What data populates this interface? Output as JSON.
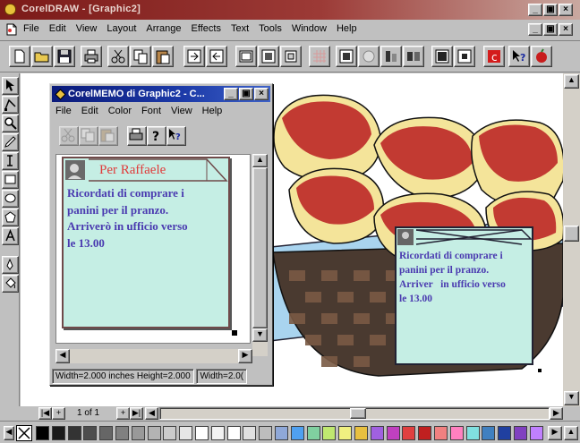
{
  "app": {
    "title": "CorelDRAW - [Graphic2]"
  },
  "menubar": {
    "items": [
      "File",
      "Edit",
      "View",
      "Layout",
      "Arrange",
      "Effects",
      "Text",
      "Tools",
      "Window",
      "Help"
    ]
  },
  "memo_window": {
    "title": "CorelMEMO di Graphic2 - C...",
    "menu": [
      "File",
      "Edit",
      "Color",
      "Font",
      "View",
      "Help"
    ],
    "note": {
      "title": "Per Raffaele",
      "lines": [
        "Ricordati di comprare i",
        "panini per il pranzo.",
        "Arriverò in ufficio verso",
        "le 13.00"
      ]
    },
    "status": [
      "Width=2.000 inches Height=2.000",
      "Width=2.0("
    ]
  },
  "canvas_note": {
    "lines": [
      "Ricordati di comprare i",
      "panini per il pranzo.",
      "Arriver   in ufficio verso",
      "le 13.00"
    ]
  },
  "page_nav": {
    "label": "1 of 1"
  },
  "palette": {
    "colors": [
      "#000000",
      "#1a1a1a",
      "#333333",
      "#4d4d4d",
      "#666666",
      "#808080",
      "#999999",
      "#b3b3b3",
      "#cccccc",
      "#e6e6e6",
      "#ffffff",
      "#f2f2f2",
      "#ffffff",
      "#e0e0e0",
      "#bdbdbd",
      "#8fa8d8",
      "#4fa0f0",
      "#80d0a0",
      "#c0e870",
      "#f0f080",
      "#e8c040",
      "#a060e0",
      "#c040c0",
      "#e04040",
      "#c02020",
      "#f08080",
      "#ff80c0",
      "#80e0e0",
      "#4080c0",
      "#2040a0",
      "#8040c0",
      "#c080ff"
    ]
  }
}
